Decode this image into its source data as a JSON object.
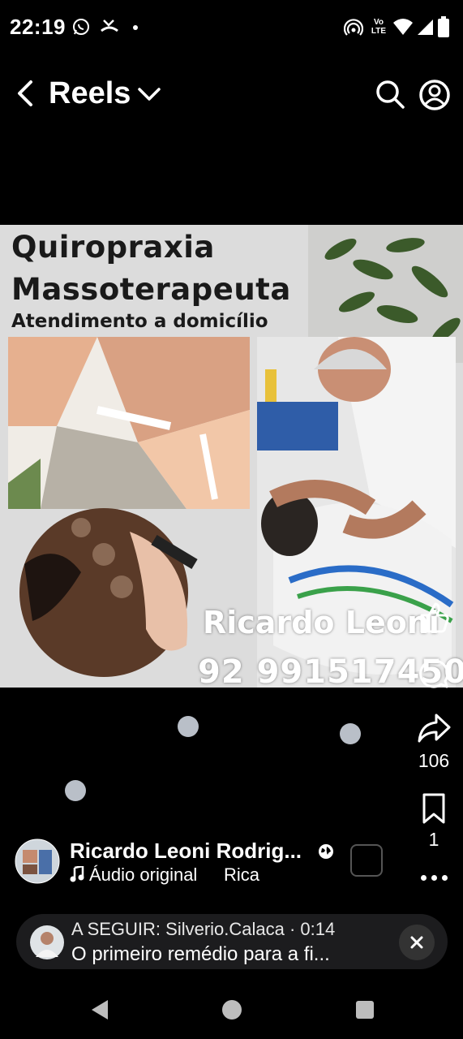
{
  "status_bar": {
    "time": "22:19",
    "left_icons": [
      "whatsapp-icon",
      "missed-call-icon",
      "dot-icon"
    ],
    "right_icons": [
      "hotspot-icon",
      "volte-icon",
      "wifi-icon",
      "signal-icon",
      "battery-icon"
    ],
    "volte_label_top": "Vo",
    "volte_label_bottom": "LTE"
  },
  "header": {
    "title": "Reels"
  },
  "poster": {
    "line1": "Quiropraxia",
    "line2": "Massoterapeuta",
    "line3": "Atendimento a domicílio",
    "name": "Ricardo Leoni",
    "phone": "92 991517450"
  },
  "actions": {
    "share_count": "106",
    "save_count": "1"
  },
  "author": {
    "name": "Ricardo Leoni Rodrig...",
    "audio_label": "Áudio original",
    "audio_scroll": "Rica"
  },
  "up_next": {
    "line1": "A SEGUIR: Silverio.Calaca · 0:14",
    "line2": "O primeiro remédio para a fi..."
  },
  "colors": {
    "background": "#000000",
    "poster_bg": "#dcdcdc",
    "dot": "#b9bfc8",
    "pill": "#1c1c1e"
  }
}
